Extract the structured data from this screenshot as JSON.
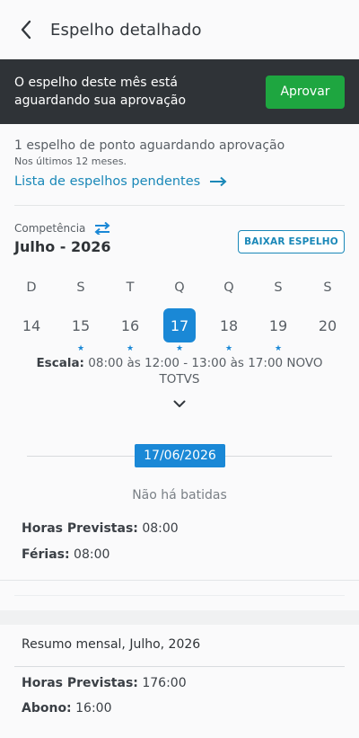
{
  "header": {
    "title": "Espelho detalhado"
  },
  "banner": {
    "text": "O espelho deste mês está aguardando sua aprovação",
    "button": "Aprovar"
  },
  "pending": {
    "title": "1 espelho de ponto aguardando aprovação",
    "subtitle": "Nos últimos 12 meses.",
    "link": "Lista de espelhos pendentes"
  },
  "competencia": {
    "label": "Competência",
    "month": "Julho - 2026",
    "download": "BAIXAR ESPELHO"
  },
  "week": {
    "days": [
      {
        "dow": "D",
        "num": "14",
        "star": ""
      },
      {
        "dow": "S",
        "num": "15",
        "star": "★"
      },
      {
        "dow": "T",
        "num": "16",
        "star": "★"
      },
      {
        "dow": "Q",
        "num": "17",
        "star": "★"
      },
      {
        "dow": "Q",
        "num": "18",
        "star": "★"
      },
      {
        "dow": "S",
        "num": "19",
        "star": "★"
      },
      {
        "dow": "S",
        "num": "20",
        "star": ""
      }
    ],
    "selected_index": 3
  },
  "scale": {
    "label": "Escala:",
    "value": "08:00 às 12:00 - 13:00 às 17:00 NOVO TOTVS"
  },
  "day_detail": {
    "date": "17/06/2026",
    "no_punches": "Não há batidas",
    "items": [
      {
        "label": "Horas Previstas:",
        "value": "08:00"
      },
      {
        "label": "Férias:",
        "value": "08:00"
      }
    ]
  },
  "summary": {
    "title": "Resumo mensal, Julho, 2026",
    "items": [
      {
        "label": "Horas Previstas:",
        "value": "176:00"
      },
      {
        "label": "Abono:",
        "value": "16:00"
      }
    ]
  },
  "colors": {
    "accent": "#1a88d6",
    "approve": "#1ea640",
    "banner": "#2f3337"
  }
}
